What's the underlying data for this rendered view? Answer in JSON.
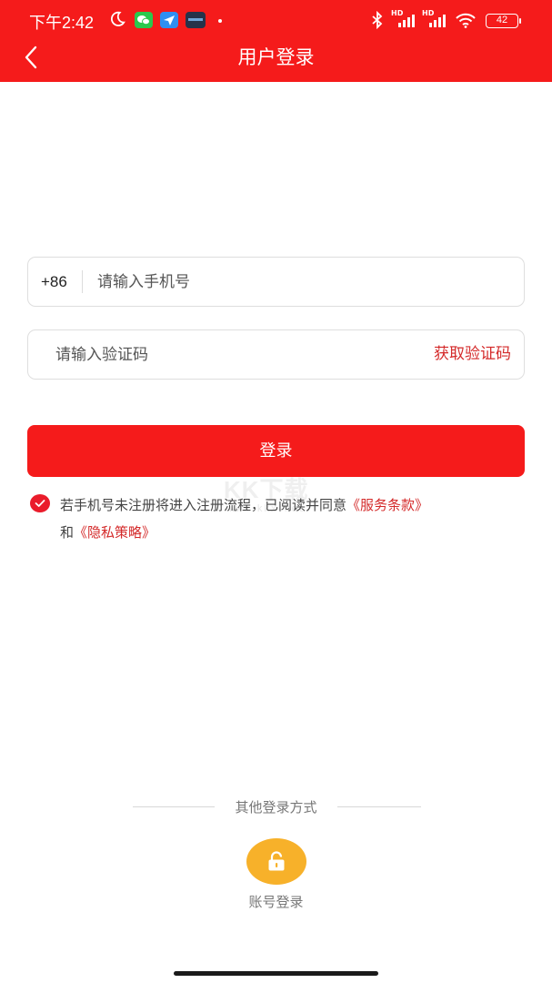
{
  "status_bar": {
    "time": "下午2:42",
    "battery": "42",
    "hd_label": "HD",
    "icons": [
      "moon-icon",
      "wechat-icon",
      "fly-icon",
      "news-icon",
      "bluetooth-icon",
      "signal-icon",
      "wifi-icon",
      "battery-icon"
    ]
  },
  "header": {
    "title": "用户登录",
    "back_icon": "chevron-left-icon"
  },
  "form": {
    "country_code": "+86",
    "phone_placeholder": "请输入手机号",
    "code_placeholder": "请输入验证码",
    "get_code_label": "获取验证码",
    "login_label": "登录"
  },
  "agreement": {
    "checked": true,
    "text_before": "若手机号未注册将进入注册流程，已阅读并同意",
    "service_terms": "《服务条款》",
    "conjunction": "和",
    "privacy_policy": "《隐私策略》"
  },
  "watermark": {
    "big": "KK下载",
    "small": "www.kkx.net"
  },
  "other_login": {
    "title": "其他登录方式",
    "account_label": "账号登录",
    "icon": "lock-icon"
  },
  "colors": {
    "brand_red": "#f51b1b",
    "link_red": "#d42a2a",
    "lock_yellow": "#f7b12a"
  }
}
